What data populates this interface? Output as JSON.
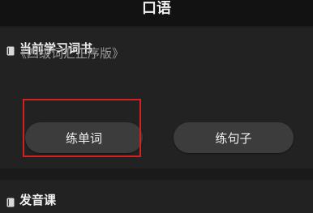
{
  "header": {
    "title": "口语"
  },
  "current_book": {
    "section_title": "当前学习词书",
    "icon": "book-icon",
    "book_name": "《四级词汇正序版》",
    "practice_words_label": "练单词",
    "practice_sentences_label": "练句子"
  },
  "pronunciation": {
    "section_title": "发音课",
    "icon": "book-icon"
  },
  "colors": {
    "background": "#1a1a1a",
    "card": "#222222",
    "button": "#3c3c3c",
    "highlight": "#d61f1f"
  }
}
